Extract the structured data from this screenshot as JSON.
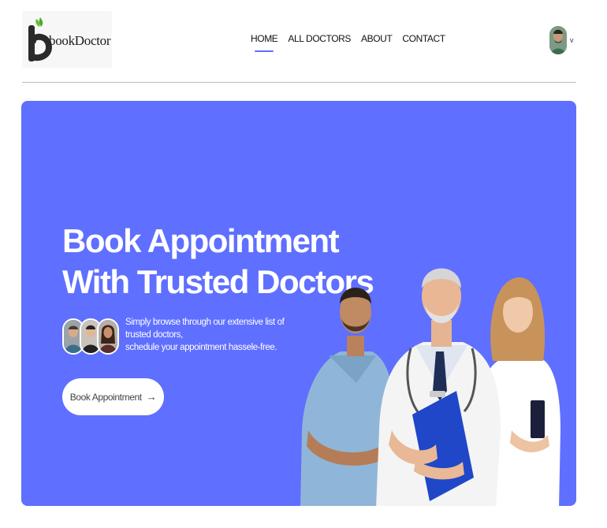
{
  "header": {
    "logo_text": "bookDoctor",
    "nav": [
      {
        "label": "HOME",
        "active": true
      },
      {
        "label": "ALL DOCTORS",
        "active": false
      },
      {
        "label": "ABOUT",
        "active": false
      },
      {
        "label": "CONTACT",
        "active": false
      }
    ],
    "profile_chevron": "v"
  },
  "hero": {
    "background_color": "#5f6fff",
    "title_line1": "Book Appointment",
    "title_line2": "With Trusted Doctors",
    "desc_line1": "Simply browse through our extensive list of trusted doctors,",
    "desc_line2": "schedule your appointment hassele-free.",
    "button_label": "Book Appointment",
    "button_icon": "arrow-right-icon"
  },
  "colors": {
    "accent": "#5f6fff",
    "white": "#ffffff"
  }
}
